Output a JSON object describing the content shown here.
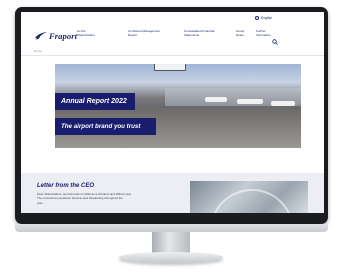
{
  "header": {
    "language_label": "English",
    "logo_text": "Fraport",
    "nav": [
      {
        "line1": "At Our",
        "line2": "Shareholders"
      },
      {
        "line1": "Combined Management",
        "line2": "Report"
      },
      {
        "line1": "Consolidated Financial",
        "line2": "Statements"
      },
      {
        "line1": "Group",
        "line2": "Notes"
      },
      {
        "line1": "Further",
        "line2": "Information"
      }
    ]
  },
  "breadcrumb": "Home",
  "hero": {
    "title": "Annual Report 2022",
    "subtitle": "The airport brand you trust"
  },
  "letter": {
    "title": "Letter from the CEO",
    "body_lines": [
      "Dear Shareholders, we look back on 2022 as a turbulent and difficult year.",
      "The coronavirus pandemic became less threatening throughout the",
      "year ..."
    ]
  },
  "colors": {
    "brand_navy": "#1a1c6e",
    "section_bg": "#eceef3"
  },
  "icons": {
    "language": "globe-icon",
    "search": "search-icon"
  }
}
